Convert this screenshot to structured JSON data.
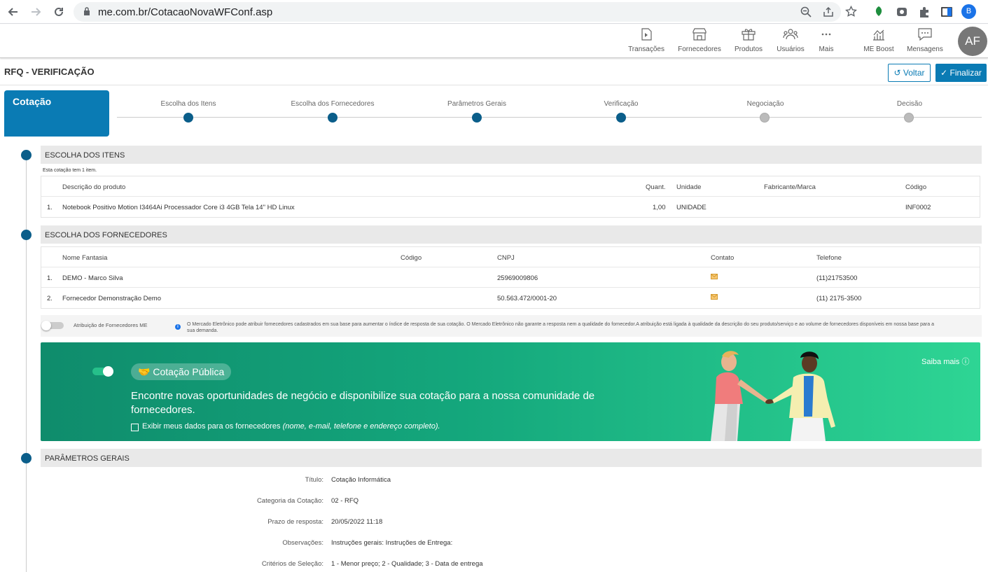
{
  "browser": {
    "url": "me.com.br/CotacaoNovaWFConf.asp",
    "profile_initial": "B"
  },
  "header": {
    "menu": [
      {
        "label": "Transações",
        "icon": "transactions-icon"
      },
      {
        "label": "Fornecedores",
        "icon": "store-icon"
      },
      {
        "label": "Produtos",
        "icon": "box-icon"
      },
      {
        "label": "Usuários",
        "icon": "users-icon"
      },
      {
        "label": "Mais",
        "icon": "more-icon"
      },
      {
        "label": "ME Boost",
        "icon": "chart-icon"
      },
      {
        "label": "Mensagens",
        "icon": "chat-icon"
      }
    ],
    "avatar": "AF"
  },
  "page": {
    "title": "RFQ - VERIFICAÇÃO",
    "back_label": "Voltar",
    "finish_label": "Finalizar"
  },
  "steps": {
    "tab_label": "Cotação",
    "items": [
      {
        "label": "Escolha dos Itens",
        "done": true
      },
      {
        "label": "Escolha dos Fornecedores",
        "done": true
      },
      {
        "label": "Parâmetros Gerais",
        "done": true
      },
      {
        "label": "Verificação",
        "done": true
      },
      {
        "label": "Negociação",
        "done": false
      },
      {
        "label": "Decisão",
        "done": false
      }
    ]
  },
  "items_section": {
    "title": "ESCOLHA DOS ITENS",
    "note": "Esta cotação tem 1 item.",
    "headers": {
      "desc": "Descrição do produto",
      "qty": "Quant.",
      "unit": "Unidade",
      "brand": "Fabricante/Marca",
      "code": "Código"
    },
    "rows": [
      {
        "num": "1.",
        "desc": "Notebook Positivo Motion I3464Ai Processador Core i3 4GB Tela 14\" HD Linux",
        "qty": "1,00",
        "unit": "UNIDADE",
        "brand": "",
        "code": "INF0002"
      }
    ]
  },
  "suppliers_section": {
    "title": "ESCOLHA DOS FORNECEDORES",
    "headers": {
      "name": "Nome Fantasia",
      "code": "Código",
      "cnpj": "CNPJ",
      "contact": "Contato",
      "phone": "Telefone"
    },
    "rows": [
      {
        "num": "1.",
        "name": "DEMO - Marco Silva",
        "code": "",
        "cnpj": "25969009806",
        "phone": "(11)21753500"
      },
      {
        "num": "2.",
        "name": "Fornecedor Demonstração Demo",
        "code": "",
        "cnpj": "50.563.472/0001-20",
        "phone": "(11) 2175-3500"
      }
    ],
    "attrib_label": "Atribuição de Fornecedores ME",
    "attrib_text": "O Mercado Eletrônico pode atribuir fornecedores cadastrados em sua base para aumentar o índice de resposta de sua cotação. O Mercado Eletrônico não garante a resposta nem a qualidade do fornecedor.A atribuição está ligada à qualidade da descrição do seu produto/serviço e ao volume de fornecedores disponíveis em nossa base para a sua demanda."
  },
  "public_banner": {
    "pill": "Cotação Pública",
    "text": "Encontre novas oportunidades de negócio e disponibilize sua cotação para a nossa comunidade de fornecedores.",
    "checkbox_label": "Exibir meus dados para os fornecedores",
    "checkbox_hint": "(nome, e-mail, telefone e endereço completo).",
    "more_label": "Saiba mais",
    "toggle_on": true
  },
  "params_section": {
    "title": "PARÂMETROS GERAIS",
    "rows": [
      {
        "label": "Título:",
        "value": "Cotação Informática"
      },
      {
        "label": "Categoria da Cotação:",
        "value": "02 - RFQ"
      },
      {
        "label": "Prazo de resposta:",
        "value": "20/05/2022 11:18"
      },
      {
        "label": "Observações:",
        "value": "Instruções gerais: Instruções de Entrega:"
      },
      {
        "label": "Critérios de Seleção:",
        "value": "1 - Menor preço; 2 - Qualidade; 3 - Data de entrega"
      }
    ]
  },
  "colors": {
    "primary": "#0a7bb4",
    "step_done": "#0b5e8a",
    "banner_start": "#0f8c6c",
    "banner_end": "#2ed594"
  }
}
